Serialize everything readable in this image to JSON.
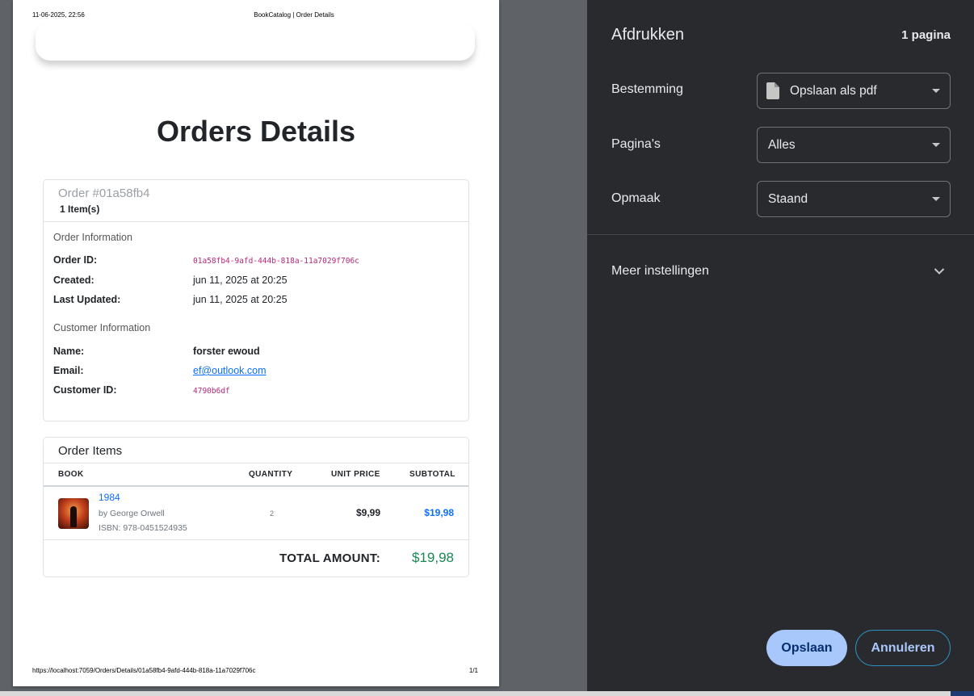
{
  "print_header": {
    "date": "11-06-2025, 22:56",
    "title": "BookCatalog | Order Details"
  },
  "print_footer": {
    "url": "https://localhost:7059/Orders/Details/01a58fb4-9afd-444b-818a-11a7029f706c",
    "page": "1/1"
  },
  "page": {
    "heading": "Orders Details",
    "order": {
      "number": "Order #01a58fb4",
      "item_count": "1 Item(s)",
      "info_heading": "Order Information",
      "id_label": "Order ID:",
      "id_value": "01a58fb4-9afd-444b-818a-11a7029f706c",
      "created_label": "Created:",
      "created_value": "jun 11, 2025 at 20:25",
      "updated_label": "Last Updated:",
      "updated_value": "jun 11, 2025 at 20:25"
    },
    "customer": {
      "heading": "Customer Information",
      "name_label": "Name:",
      "name_value": "forster ewoud",
      "email_label": "Email:",
      "email_value": "ef@outlook.com",
      "id_label": "Customer ID:",
      "id_value": "4790b6df"
    },
    "items": {
      "heading": "Order Items",
      "columns": [
        "BOOK",
        "QUANTITY",
        "UNIT PRICE",
        "SUBTOTAL"
      ],
      "rows": [
        {
          "title": "1984",
          "author": "by George Orwell",
          "isbn": "ISBN: 978-0451524935",
          "quantity": "2",
          "unit_price": "$9,99",
          "subtotal": "$19,98"
        }
      ],
      "total_label": "TOTAL AMOUNT:",
      "total_value": "$19,98"
    }
  },
  "dialog": {
    "title": "Afdrukken",
    "page_count": "1 pagina",
    "destination_label": "Bestemming",
    "destination_value": "Opslaan als pdf",
    "pages_label": "Pagina's",
    "pages_value": "Alles",
    "layout_label": "Opmaak",
    "layout_value": "Staand",
    "more_settings": "Meer instellingen",
    "save_button": "Opslaan",
    "cancel_button": "Annuleren"
  },
  "colors": {
    "dialog_bg": "#292a2d",
    "save_button_bg": "#a8c7fa",
    "link_blue": "#0d6efd",
    "total_green": "#198754"
  },
  "icons": [
    "file-icon",
    "chevron-down-icon",
    "dropdown-caret-icon"
  ]
}
